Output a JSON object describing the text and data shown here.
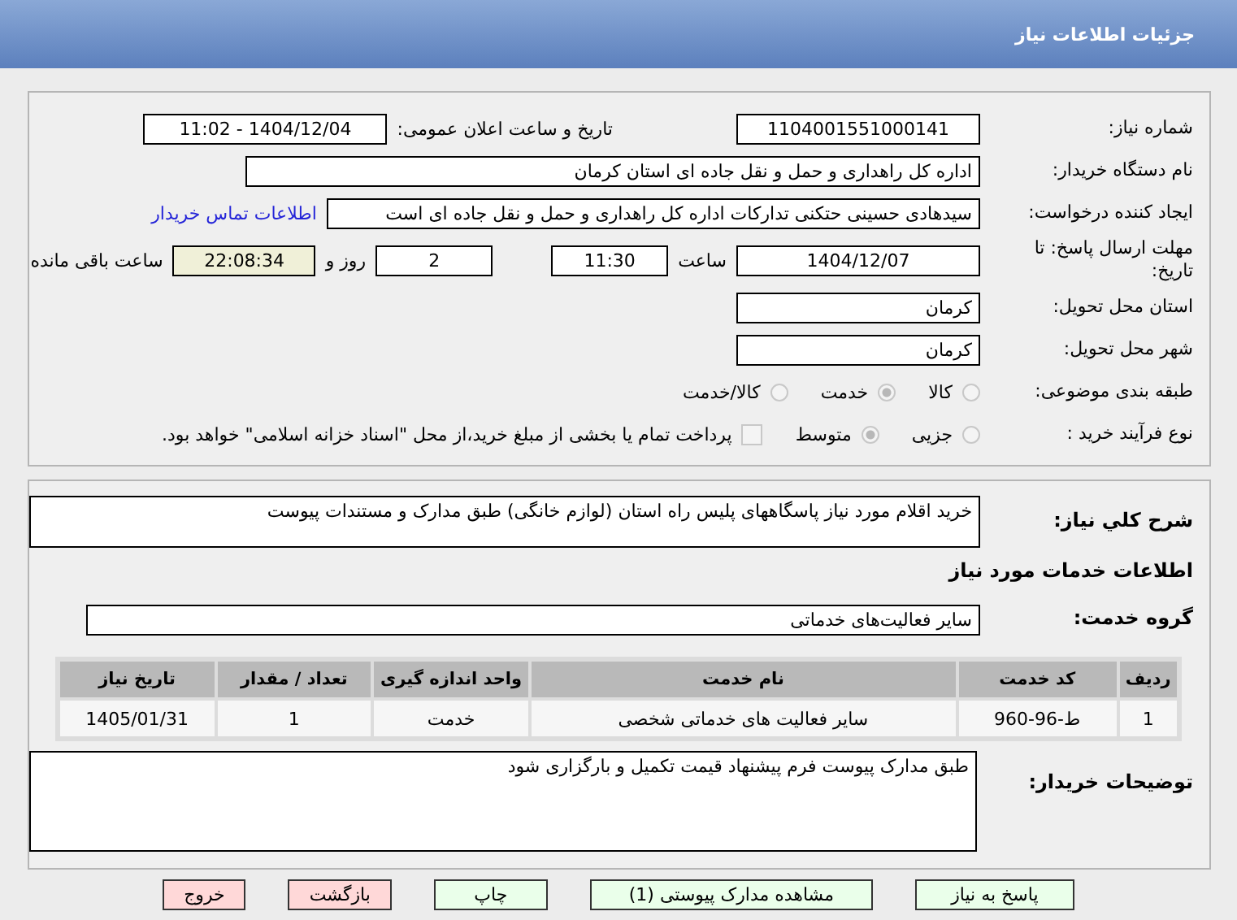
{
  "header": {
    "title": "جزئیات اطلاعات نیاز"
  },
  "details": {
    "need_number": {
      "label": "شماره نیاز:",
      "value": "1104001551000141"
    },
    "announce": {
      "label": "تاریخ و ساعت اعلان عمومی:",
      "value": "1404/12/04 - 11:02"
    },
    "buyer": {
      "label": "نام دستگاه خریدار:",
      "value": "اداره کل راهداری و حمل و نقل جاده ای استان کرمان"
    },
    "creator": {
      "label": "ایجاد کننده درخواست:",
      "value": "سیدهادی حسینی حتکنی تدارکات اداره کل راهداری و حمل و نقل جاده ای است",
      "link": "اطلاعات تماس خریدار"
    },
    "deadline": {
      "label": "مهلت ارسال پاسخ: تا تاریخ:",
      "date": "1404/12/07",
      "time_label": "ساعت",
      "time": "11:30",
      "days": "2",
      "days_label": "روز و",
      "remaining": "22:08:34",
      "remaining_label": "ساعت باقی مانده"
    },
    "province": {
      "label": "استان محل تحویل:",
      "value": "کرمان"
    },
    "city": {
      "label": "شهر محل تحویل:",
      "value": "کرمان"
    },
    "category": {
      "label": "طبقه بندی موضوعی:",
      "options": [
        {
          "label": "کالا",
          "selected": false
        },
        {
          "label": "خدمت",
          "selected": true
        },
        {
          "label": "کالا/خدمت",
          "selected": false
        }
      ]
    },
    "process": {
      "label": "نوع فرآیند خرید :",
      "options": [
        {
          "label": "جزیی",
          "selected": false
        },
        {
          "label": "متوسط",
          "selected": true
        }
      ],
      "treasury": {
        "label": "پرداخت تمام یا بخشی از مبلغ خرید،از محل \"اسناد خزانه اسلامی\" خواهد بود.",
        "checked": false
      }
    }
  },
  "services": {
    "summary": {
      "label": "شرح کلي نياز:",
      "value": "خرید اقلام مورد نیاز پاسگاههای پلیس راه استان (لوازم خانگی) طبق مدارک و مستندات پیوست"
    },
    "heading": "اطلاعات خدمات مورد نیاز",
    "group": {
      "label": "گروه خدمت:",
      "value": "سایر فعالیت‌های خدماتی"
    },
    "table": {
      "columns": [
        "ردیف",
        "کد خدمت",
        "نام خدمت",
        "واحد اندازه گیری",
        "تعداد / مقدار",
        "تاریخ نیاز"
      ],
      "rows": [
        [
          "1",
          "ط-96-960",
          "سایر فعالیت های خدماتی شخصی",
          "خدمت",
          "1",
          "1405/01/31"
        ]
      ]
    },
    "notes": {
      "label": "توضیحات خریدار:",
      "value": "طبق مدارک پیوست فرم پیشنهاد قیمت تکمیل و بارگزاری شود"
    }
  },
  "buttons": [
    {
      "label": "پاسخ به نیاز",
      "kind": "normal"
    },
    {
      "label": "مشاهده مدارک پیوستی (1)",
      "kind": "normal"
    },
    {
      "label": "چاپ",
      "kind": "normal"
    },
    {
      "label": "بازگشت",
      "kind": "danger"
    },
    {
      "label": "خروج",
      "kind": "danger"
    }
  ]
}
